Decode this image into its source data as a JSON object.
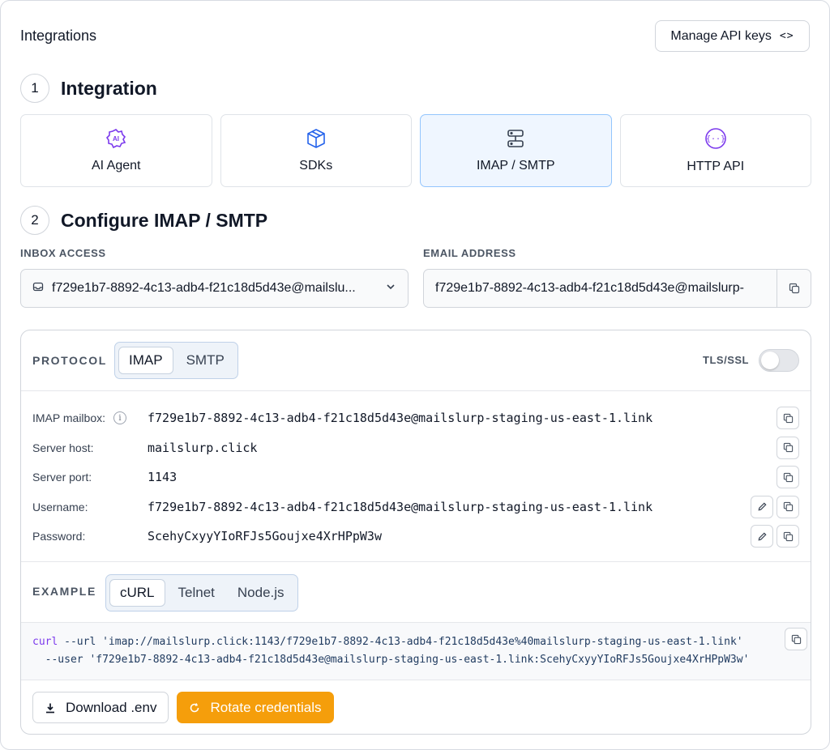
{
  "header": {
    "title": "Integrations",
    "api_button": "Manage API keys"
  },
  "step1": {
    "num": "1",
    "title": "Integration"
  },
  "tiles": [
    {
      "label": "AI Agent",
      "icon": "ai-agent-icon"
    },
    {
      "label": "SDKs",
      "icon": "cube-icon"
    },
    {
      "label": "IMAP / SMTP",
      "icon": "server-icon",
      "selected": true
    },
    {
      "label": "HTTP API",
      "icon": "api-braces-icon"
    }
  ],
  "step2": {
    "num": "2",
    "title": "Configure IMAP / SMTP"
  },
  "inbox_access": {
    "label": "INBOX ACCESS",
    "value": "f729e1b7-8892-4c13-adb4-f21c18d5d43e@mailslu..."
  },
  "email_address": {
    "label": "EMAIL ADDRESS",
    "value": "f729e1b7-8892-4c13-adb4-f21c18d5d43e@mailslurp-"
  },
  "protocol": {
    "label": "PROTOCOL",
    "options": [
      "IMAP",
      "SMTP"
    ],
    "selected": "IMAP",
    "tls_label": "TLS/SSL",
    "tls_enabled": false
  },
  "details": [
    {
      "label": "IMAP mailbox:",
      "value": "f729e1b7-8892-4c13-adb4-f21c18d5d43e@mailslurp-staging-us-east-1.link"
    },
    {
      "label": "Server host:",
      "value": "mailslurp.click"
    },
    {
      "label": "Server port:",
      "value": "1143"
    },
    {
      "label": "Username:",
      "value": "f729e1b7-8892-4c13-adb4-f21c18d5d43e@mailslurp-staging-us-east-1.link"
    },
    {
      "label": "Password:",
      "value": "ScehyCxyyYIoRFJs5Goujxe4XrHPpW3w"
    }
  ],
  "example": {
    "label": "EXAMPLE",
    "tabs": [
      "cURL",
      "Telnet",
      "Node.js"
    ],
    "selected": "cURL",
    "code_cmd": "curl",
    "code_line1_rest": " --url 'imap://mailslurp.click:1143/f729e1b7-8892-4c13-adb4-f21c18d5d43e%40mailslurp-staging-us-east-1.link'",
    "code_line2": "  --user 'f729e1b7-8892-4c13-adb4-f21c18d5d43e@mailslurp-staging-us-east-1.link:ScehyCxyyYIoRFJs5Goujxe4XrHPpW3w'"
  },
  "buttons": {
    "download": "Download .env",
    "rotate": "Rotate credentials"
  },
  "colors": {
    "accent_blue": "#3b82f6",
    "selected_tile_bg": "#eff6ff",
    "primary_orange": "#f59e0b",
    "ai_purple": "#7c3aed"
  }
}
